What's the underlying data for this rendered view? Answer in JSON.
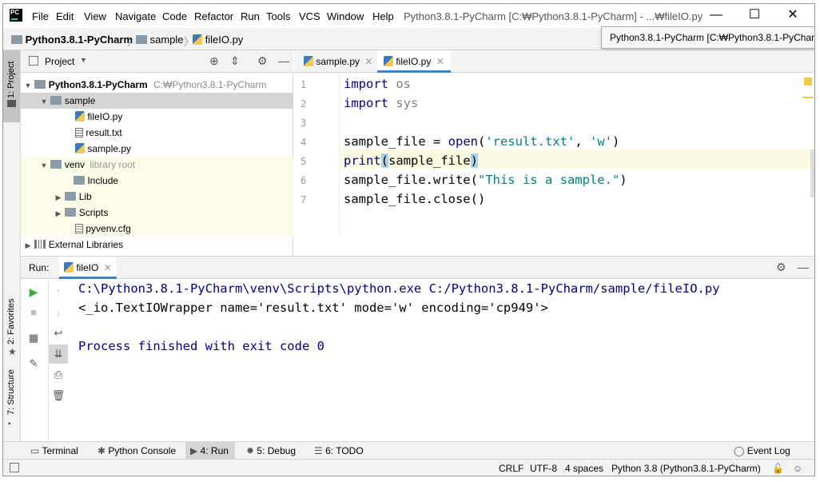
{
  "titlebar": {
    "menus": [
      "File",
      "Edit",
      "View",
      "Navigate",
      "Code",
      "Refactor",
      "Run",
      "Tools",
      "VCS",
      "Window",
      "Help"
    ],
    "window_title": "Python3.8.1-PyCharm [C:₩Python3.8.1-PyCharm] - ...₩fileIO.py"
  },
  "navbar": {
    "project": "Python3.8.1-PyCharm",
    "folder": "sample",
    "file": "fileIO.py"
  },
  "tooltip": "Python3.8.1-PyCharm [C:₩Python3.8.1-PyCharm]",
  "left_strip": {
    "project": "1: Project",
    "favorites": "2: Favorites",
    "structure": "7: Structure"
  },
  "project_panel": {
    "title": "Project",
    "root": "Python3.8.1-PyCharm",
    "root_path": "C:₩Python3.8.1-PyCharm",
    "sample": "sample",
    "files": [
      "fileIO.py",
      "result.txt",
      "sample.py"
    ],
    "venv": "venv",
    "venv_hint": "library root",
    "venv_children": [
      "Include",
      "Lib",
      "Scripts",
      "pyvenv.cfg"
    ],
    "external": "External Libraries"
  },
  "editor": {
    "tabs": [
      "sample.py",
      "fileIO.py"
    ],
    "line_numbers": [
      "1",
      "2",
      "3",
      "4",
      "5",
      "6",
      "7"
    ]
  },
  "run": {
    "label": "Run:",
    "tab": "fileIO",
    "output": [
      "C:\\Python3.8.1-PyCharm\\venv\\Scripts\\python.exe C:/Python3.8.1-PyCharm/sample/fileIO.py",
      "<_io.TextIOWrapper name='result.txt' mode='w' encoding='cp949'>",
      "",
      "Process finished with exit code 0"
    ]
  },
  "bottom_tabs": {
    "terminal": "Terminal",
    "console": "Python Console",
    "run": "4: Run",
    "debug": "5: Debug",
    "todo": "6: TODO",
    "event_log": "Event Log"
  },
  "status": {
    "line_sep": "CRLF",
    "encoding": "UTF-8",
    "indent": "4 spaces",
    "interpreter": "Python 3.8 (Python3.8.1-PyCharm)"
  }
}
